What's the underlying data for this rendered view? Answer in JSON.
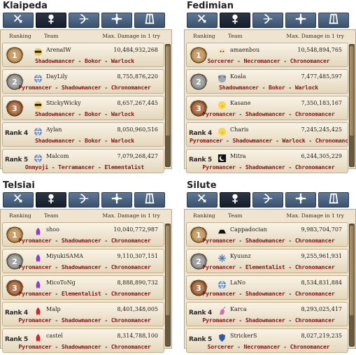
{
  "tab_icons": [
    "sword-icon",
    "skull-staff-icon",
    "bow-icon",
    "cross-icon",
    "robe-icon"
  ],
  "columns": {
    "ranking": "Ranking",
    "team": "Team",
    "damage": "Max. Damage in 1 try"
  },
  "panels": [
    {
      "name": "Klaipeda",
      "active_tab": 1,
      "rows": [
        {
          "rank": "1",
          "name": "ArenaIW",
          "damage": "10,484,932,268",
          "avatar": "sunglasses-icon",
          "classes": "Shadowmancer - Bokor - Warlock"
        },
        {
          "rank": "2",
          "name": "DayLily",
          "damage": "8,755,876,220",
          "avatar": "globe-icon",
          "classes": "Pyromancer - Shadowmancer - Chronomancer"
        },
        {
          "rank": "3",
          "name": "StickyWicky",
          "damage": "8,657,267,445",
          "avatar": "sunglasses-icon",
          "classes": "Shadowmancer - Bokor - Warlock"
        },
        {
          "rank": "Rank 4",
          "name": "Aylan",
          "damage": "8,050,960,516",
          "avatar": "globe-icon",
          "classes": "Shadowmancer - Bokor - Warlock"
        },
        {
          "rank": "Rank 5",
          "name": "Malcom",
          "damage": "7,079,268,427",
          "avatar": "globe-icon",
          "classes": "Onmyoji - Terramancer - Elementalist"
        }
      ]
    },
    {
      "name": "Fedimian",
      "active_tab": 1,
      "rows": [
        {
          "rank": "1",
          "name": "amaenbou",
          "damage": "10,548,894,765",
          "avatar": "face-icon",
          "classes": "Sorcerer - Necromancer - Chronomancer"
        },
        {
          "rank": "2",
          "name": "Koala",
          "damage": "7,477,485,597",
          "avatar": "koala-icon",
          "classes": "Shadowmancer - Bokor - Warlock"
        },
        {
          "rank": "3",
          "name": "Kasane",
          "damage": "7,350,183,167",
          "avatar": "chick-icon",
          "classes": "Pyromancer - Shadowmancer - Chronomancer"
        },
        {
          "rank": "Rank 4",
          "name": "Charis",
          "damage": "7,245,245,425",
          "avatar": "chick-icon",
          "classes": "Pyromancer - Shadowmancer - Warlock - Chronomancer"
        },
        {
          "rank": "Rank 5",
          "name": "Mitra",
          "damage": "6,244,305,229",
          "avatar": "moon-icon",
          "classes": "Pyromancer - Shadowmancer - Chronomancer"
        }
      ]
    },
    {
      "name": "Telsiai",
      "active_tab": 1,
      "rows": [
        {
          "rank": "1",
          "name": "shoo",
          "damage": "10,040,772,987",
          "avatar": "flame-icon",
          "classes": "Pyromancer - Shadowmancer - Chronomancer"
        },
        {
          "rank": "2",
          "name": "MiyukiSAMA",
          "damage": "9,110,307,151",
          "avatar": "flame-icon",
          "classes": "Pyromancer - Shadowmancer - Chronomancer"
        },
        {
          "rank": "3",
          "name": "MicoToNg",
          "damage": "8,888,890,732",
          "avatar": "flame-icon",
          "classes": "Pyromancer - Elementalist - Chronomancer"
        },
        {
          "rank": "Rank 4",
          "name": "Malp",
          "damage": "8,401,348,005",
          "avatar": "red-flame-icon",
          "classes": "Pyromancer - Shadowmancer - Chronomancer"
        },
        {
          "rank": "Rank 5",
          "name": "castel",
          "damage": "8,314,788,100",
          "avatar": "red-flame-icon",
          "classes": "Pyromancer - Shadowmancer - Chronomancer"
        }
      ]
    },
    {
      "name": "Silute",
      "active_tab": 1,
      "rows": [
        {
          "rank": "1",
          "name": "Cappadocian",
          "damage": "9,983,704,707",
          "avatar": "hat-icon",
          "classes": "Pyromancer - Shadowmancer - Chronomancer"
        },
        {
          "rank": "2",
          "name": "Kyuunz",
          "damage": "9,255,961,931",
          "avatar": "snowflake-icon",
          "classes": "Pyromancer - Elementalist - Chronomancer"
        },
        {
          "rank": "3",
          "name": "LaNo",
          "damage": "8,534,831,884",
          "avatar": "globe-icon",
          "classes": "Pyromancer - Shadowmancer - Chronomancer"
        },
        {
          "rank": "Rank 4",
          "name": "Karca",
          "damage": "8,293,025,417",
          "avatar": "unicorn-icon",
          "classes": "Pyromancer - Shadowmancer - Chronomancer"
        },
        {
          "rank": "Rank 5",
          "name": "StrickerS",
          "damage": "8,027,219,235",
          "avatar": "shield-icon",
          "classes": "Sorcerer - Necromancer - Chronomancer"
        }
      ]
    }
  ]
}
